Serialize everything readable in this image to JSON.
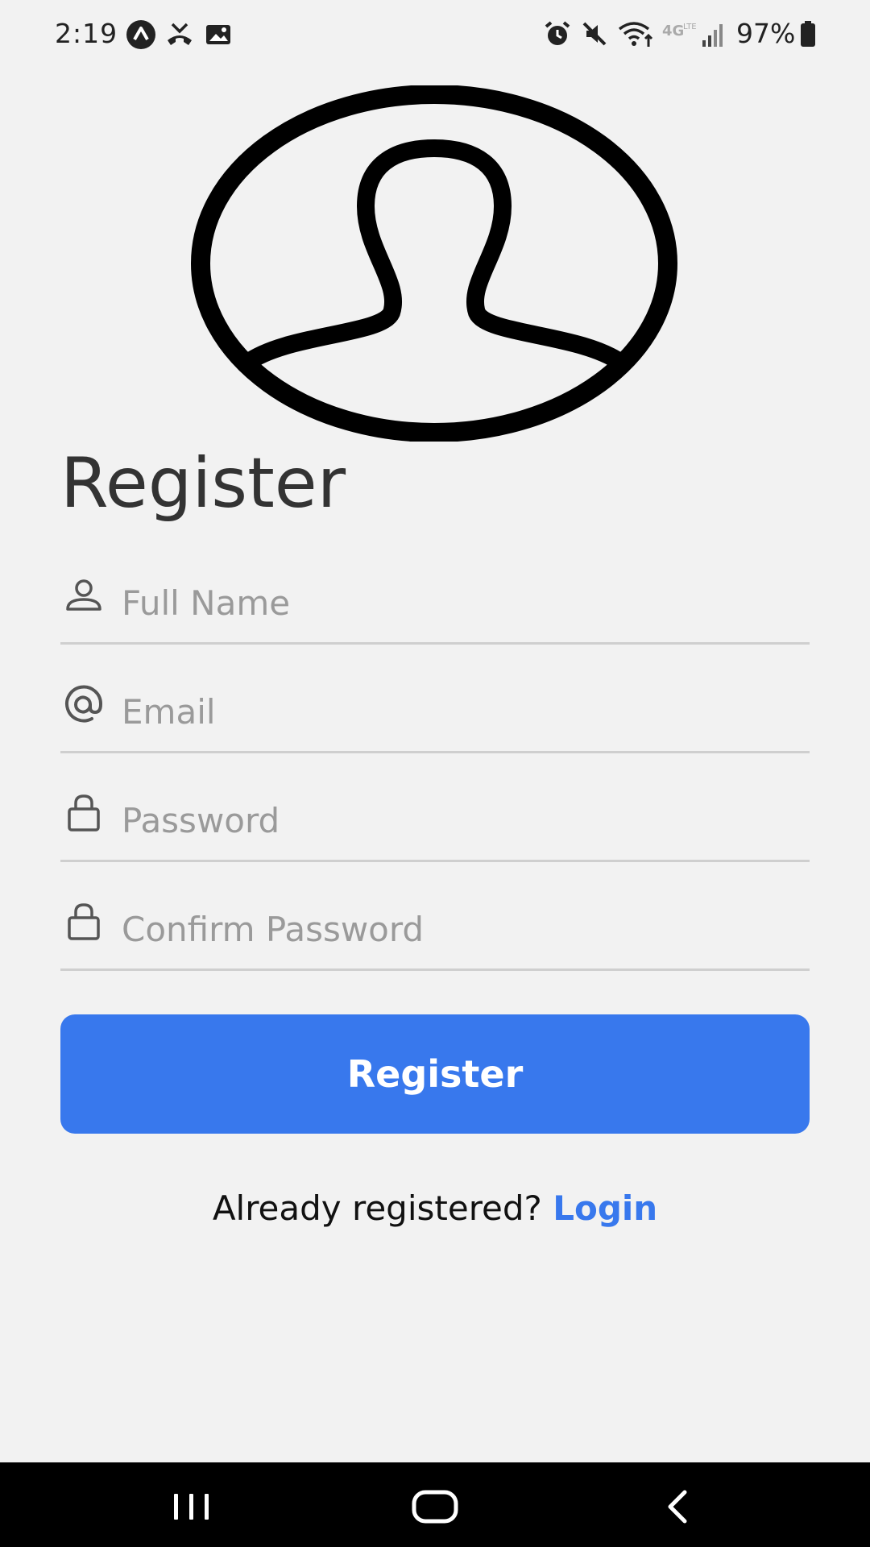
{
  "status_bar": {
    "time": "2:19",
    "battery": "97%",
    "icons": [
      "app-notification-icon",
      "missed-call-icon",
      "image-icon",
      "alarm-icon",
      "mute-icon",
      "wifi-icon",
      "4g-icon",
      "signal-icon",
      "battery-icon"
    ]
  },
  "form": {
    "title": "Register",
    "full_name_placeholder": "Full Name",
    "email_placeholder": "Email",
    "password_placeholder": "Password",
    "confirm_password_placeholder": "Confirm Password",
    "submit_label": "Register",
    "already_registered": "Already registered?",
    "login_label": "Login"
  },
  "colors": {
    "accent": "#3878ed",
    "background": "#f2f2f2"
  }
}
